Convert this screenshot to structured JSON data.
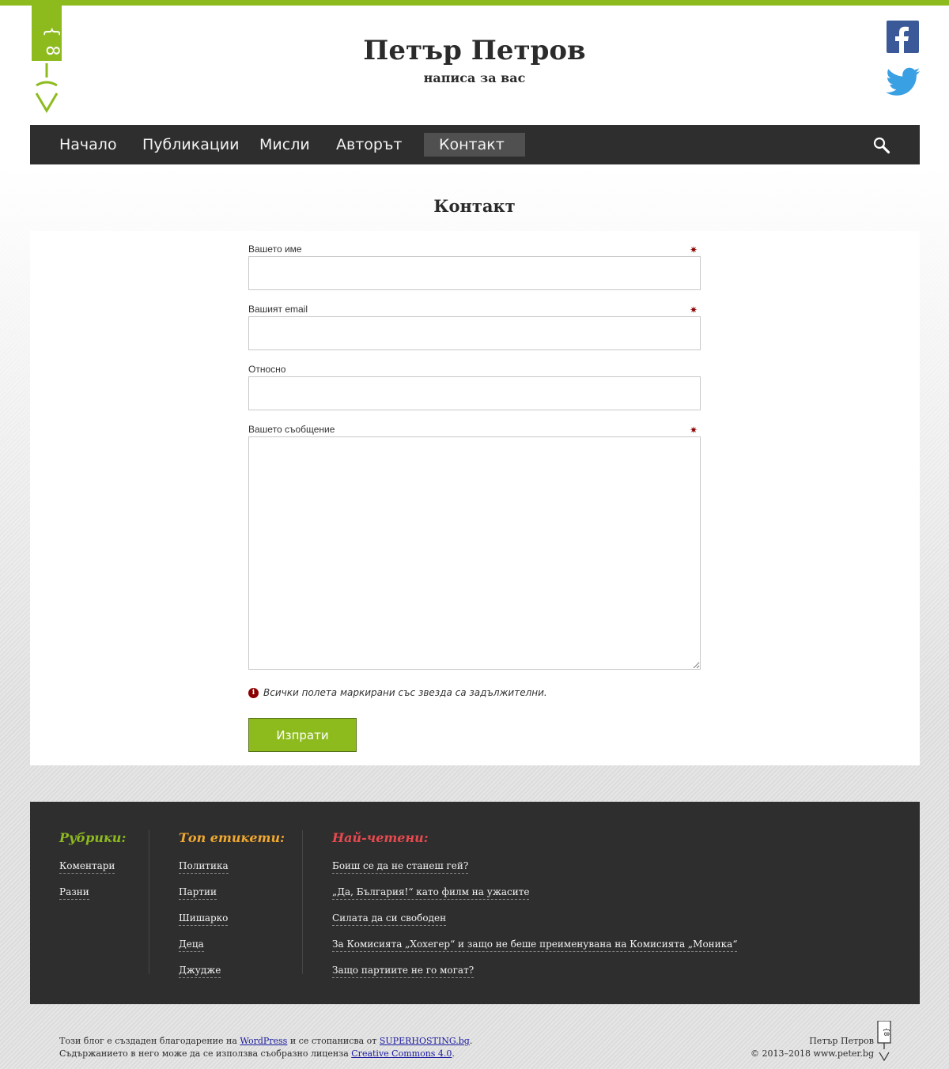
{
  "header": {
    "title": "Петър Петров",
    "tagline": "написа за вас"
  },
  "social": {
    "facebook": "facebook-icon",
    "twitter": "twitter-icon"
  },
  "nav": {
    "items": [
      {
        "label": "Начало"
      },
      {
        "label": "Публикации"
      },
      {
        "label": "Мисли"
      },
      {
        "label": "Авторът"
      },
      {
        "label": "Контакт",
        "active": true
      }
    ],
    "search_icon": "search-icon"
  },
  "page": {
    "title": "Контакт"
  },
  "form": {
    "name_label": "Вашето име",
    "email_label": "Вашият email",
    "subject_label": "Относно",
    "message_label": "Вашето съобщение",
    "required_star": "✷",
    "notice_icon": "i",
    "notice": "Всички полета маркирани със звезда са задължителни.",
    "submit_label": "Изпрати"
  },
  "footer": {
    "categories": {
      "heading": "Рубрики:",
      "color": "#8dbb1e",
      "links": [
        "Коментари",
        "Разни"
      ]
    },
    "tags": {
      "heading": "Топ етикети:",
      "color": "#f0a830",
      "links": [
        "Политика",
        "Партии",
        "Шишарко",
        "Деца",
        "Джудже"
      ]
    },
    "popular": {
      "heading": "Най-четени:",
      "color": "#e8494f",
      "links": [
        "Боиш се да не станеш гей?",
        "„Да, България!“ като филм на ужасите",
        "Силата да си свободен",
        "За Комисията „Хохегер“ и защо не беше преименувана на Комисията „Моника“",
        "Защо партиите не го могат?"
      ]
    }
  },
  "bottom": {
    "line1_prefix": "Този блог е създаден благодарение на ",
    "wordpress": "WordPress",
    "line1_mid": " и се стопанисва от ",
    "superhosting": "SUPERHOSTING.bg",
    "line1_suffix": ".",
    "line2_prefix": "Съдържанието в него може да се използва съобразно лиценза ",
    "cc": "Creative Commons 4.0",
    "line2_suffix": ".",
    "author": "Петър Петров",
    "copyright": "© 2013–2018 www.peter.bg"
  },
  "colors": {
    "accent": "#8dbb1e",
    "nav_bg": "#2e2e2e",
    "required": "#8b0000"
  }
}
